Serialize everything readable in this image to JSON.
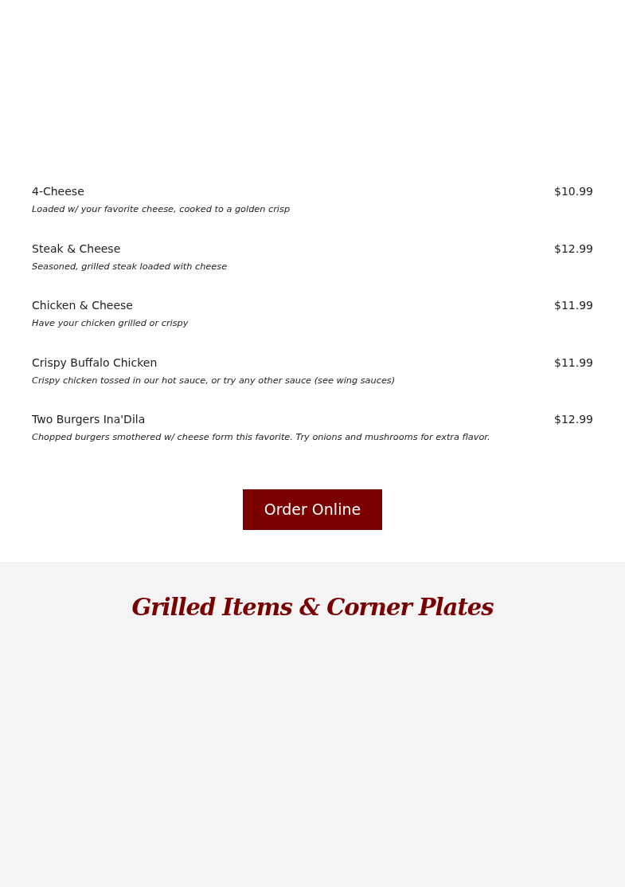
{
  "menu_items": [
    {
      "name": "4-Cheese",
      "price": "$10.99",
      "description": "Loaded w/ your favorite cheese, cooked to a golden crisp"
    },
    {
      "name": "Steak & Cheese",
      "price": "$12.99",
      "description": "Seasoned, grilled steak loaded with cheese"
    },
    {
      "name": "Chicken & Cheese",
      "price": "$11.99",
      "description": "Have your chicken grilled or crispy"
    },
    {
      "name": "Crispy Buffalo Chicken",
      "price": "$11.99",
      "description": "Crispy chicken tossed in our hot sauce, or try any other sauce (see wing sauces)"
    },
    {
      "name": "Two Burgers Ina'Dila",
      "price": "$12.99",
      "description": "Chopped burgers smothered w/ cheese form this favorite. Try onions and mushrooms for extra flavor."
    }
  ],
  "order_button": "Order Online",
  "section_heading": "Grilled Items & Corner Plates"
}
